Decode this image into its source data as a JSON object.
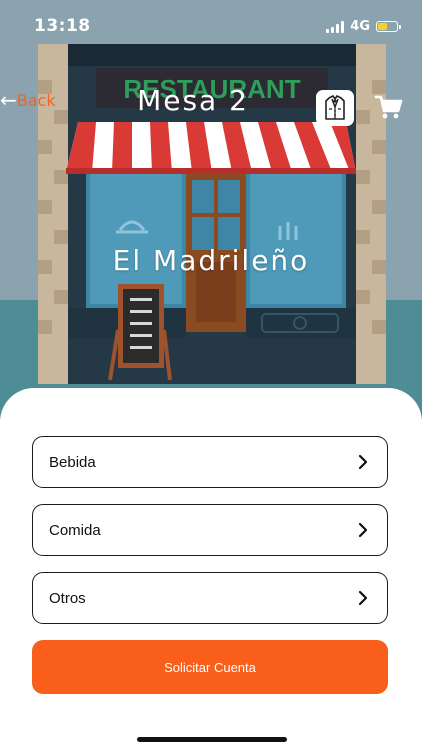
{
  "status_bar": {
    "time": "13:18",
    "network": "4G",
    "battery_level": 0.5
  },
  "header": {
    "back_label": "Back",
    "back_icon": "arrow-left-icon",
    "title": "Mesa 2",
    "waiter_icon": "waiter-icon",
    "cart_icon": "cart-icon"
  },
  "hero": {
    "sign_text": "RESTAURANT",
    "restaurant_name": "El Madrileño"
  },
  "menu": {
    "items": [
      {
        "label": "Bebida"
      },
      {
        "label": "Comida"
      },
      {
        "label": "Otros"
      }
    ]
  },
  "actions": {
    "request_bill_label": "Solicitar Cuenta"
  },
  "colors": {
    "accent": "#f95f1b",
    "back_text": "#f26522",
    "sign_green": "#2e9e5b",
    "awning_red": "#d93a35"
  }
}
